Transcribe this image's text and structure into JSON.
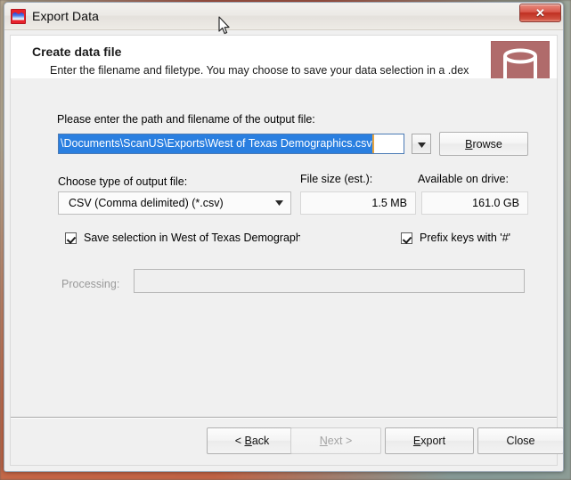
{
  "window": {
    "title": "Export Data",
    "icon": "app-icon",
    "close_label": "✕"
  },
  "header": {
    "title": "Create data file",
    "description": "Enter the filename and filetype. You may choose to save your data selection in a .dex file for future use. Click 'Process' to produce the data file.",
    "icon": "database-icon",
    "icon_bg": "#b06b6b"
  },
  "form": {
    "path_label": "Please enter the path and filename of the output file:",
    "path_value": "\\Documents\\ScanUS\\Exports\\West of Texas Demographics.csv",
    "path_selected": true,
    "path_dropdown_icon": "chevron-down-icon",
    "browse_label": "Browse",
    "browse_accel": "B",
    "type_label": "Choose type of output file:",
    "type_value": "CSV (Comma delimited) (*.csv)",
    "type_options": [
      "CSV (Comma delimited) (*.csv)"
    ],
    "type_dropdown_icon": "chevron-down-icon",
    "filesize_label": "File size (est.):",
    "filesize_value": "1.5 MB",
    "available_label": "Available on drive:",
    "available_value": "161.0 GB",
    "save_selection_label": "Save selection in West of Texas Demograph",
    "save_selection_checked": true,
    "prefix_keys_label": "Prefix keys with '#'",
    "prefix_keys_checked": true,
    "processing_label": "Processing:",
    "processing_disabled": true,
    "processing_value": ""
  },
  "footer": {
    "back_label": "< Back",
    "back_accel": "B",
    "next_label": "Next >",
    "next_accel": "N",
    "next_disabled": true,
    "export_label": "Export",
    "export_accel": "E",
    "close_label": "Close"
  },
  "colors": {
    "selection_blue": "#2a7fe0",
    "close_red": "#bf2f21",
    "accent_rose": "#b06b6b",
    "dialog_bg": "#f0f0f0"
  }
}
